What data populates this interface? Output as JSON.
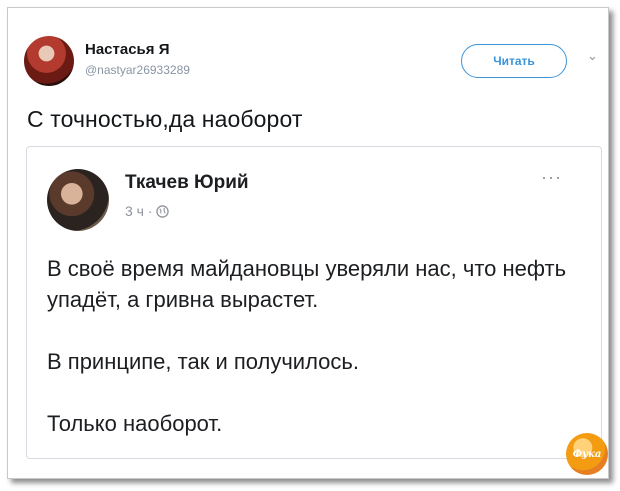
{
  "tweet": {
    "author_name": "Настасья Я",
    "author_handle": "@nastyar26933289",
    "follow_label": "Читать",
    "text": "С точностью,да наоборот"
  },
  "quoted_post": {
    "author_name": "Ткачев Юрий",
    "time": "3 ч ·",
    "paragraphs": [
      "В своё время майдановцы уверяли нас, что нефть упадёт, а гривна вырастет.",
      "В принципе, так и получилось.",
      "Только наоборот."
    ]
  },
  "watermark_text": "Фука",
  "colors": {
    "follow_blue": "#3b94d9",
    "text_dark": "#14171a",
    "meta_gray": "#8a96a3"
  },
  "icons": {
    "globe": "globe-icon",
    "more": "more-icon",
    "chevron": "chevron-down-icon"
  }
}
